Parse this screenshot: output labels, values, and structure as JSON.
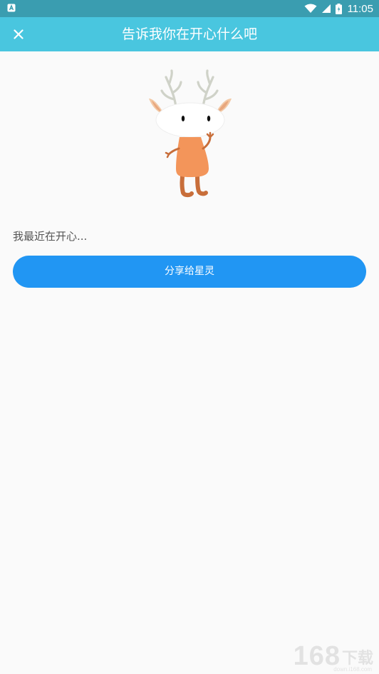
{
  "status_bar": {
    "time": "11:05"
  },
  "app_bar": {
    "title": "告诉我你在开心什么吧"
  },
  "main": {
    "prompt_text": "我最近在开心...",
    "share_button_label": "分享给星灵"
  },
  "watermark": {
    "number": "168",
    "word": "下载",
    "domain": "down.i168.com"
  },
  "colors": {
    "status_bar": "#3a9db0",
    "app_bar": "#49c6df",
    "button": "#2196f3",
    "background": "#fafafa",
    "mascot_body": "#f3955a"
  },
  "icons": [
    "notification-icon",
    "wifi-icon",
    "signal-icon",
    "battery-icon",
    "close-icon",
    "deer-mascot-illustration"
  ]
}
